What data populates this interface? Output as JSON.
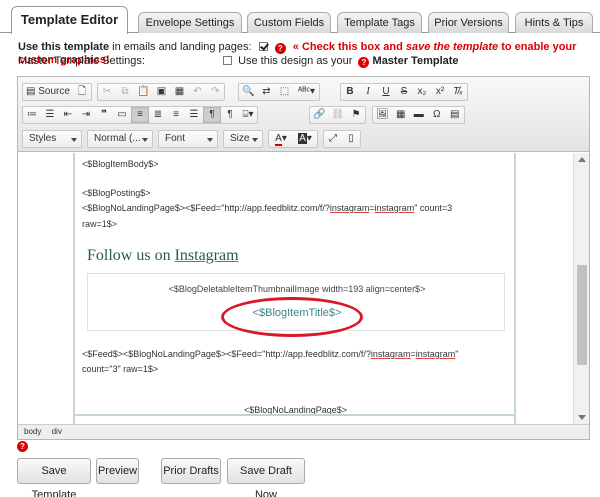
{
  "tabs": [
    {
      "label": "Template Editor",
      "active": true
    },
    {
      "label": "Envelope Settings"
    },
    {
      "label": "Custom Fields"
    },
    {
      "label": "Template Tags"
    },
    {
      "label": "Prior Versions"
    },
    {
      "label": "Hints & Tips"
    }
  ],
  "options": {
    "use_template_label": "Use this template",
    "use_template_suffix": " in emails and landing pages:",
    "use_template_checked": true,
    "warning_prefix": "« Check this box and ",
    "warning_italic": "save the template",
    "warning_suffix": " to enable your custom graphics!",
    "master_label": "Master Template Settings:",
    "master_checkbox_label": "Use this design as your",
    "master_template_label": "Master Template",
    "master_checked": false
  },
  "toolbar": {
    "row1": [
      "Source",
      "New Page",
      "Cut",
      "Copy",
      "Paste",
      "Paste as text",
      "Paste from Word",
      "Undo",
      "Redo",
      "Find",
      "Replace",
      "Select All",
      "Spell Check",
      "Bold",
      "Italic",
      "Underline",
      "Strike",
      "Subscript",
      "Superscript",
      "Remove Format"
    ],
    "source_label": "Source",
    "combos": {
      "styles": "Styles",
      "format": "Normal (...",
      "font": "Font",
      "size": "Size"
    }
  },
  "content": {
    "blog_item_body": "<$BlogItemBody$>",
    "blog_posting": "<$BlogPosting$>",
    "feed_line_1a": "<$BlogNoLandingPage$><$Feed=\"http://app.feedblitz.com/f/?",
    "feed_word": "instagram",
    "feed_line_1b": "=",
    "feed_line_1c": "\" count=3",
    "feed_line_2": "raw=1$>",
    "heading_prefix": "Follow us on ",
    "heading_word": "Instagram",
    "thumb_line": "<$BlogDeletableItemThumbnailImage width=193 align=center$>",
    "item_title": "<$BlogItemTitle$>",
    "end_feed_a": "<$Feed$><$BlogNoLandingPage$><$Feed=\"http://app.feedblitz.com/f/?",
    "end_feed_b": "\"",
    "end_feed_2": "count=\"3\" raw=1$>",
    "no_landing": "<$BlogNoLandingPage$>"
  },
  "statusbar": [
    "body",
    "div"
  ],
  "buttons": {
    "save_template": "Save Template",
    "preview": "Preview",
    "prior_drafts": "Prior Drafts",
    "save_draft_now": "Save Draft Now"
  },
  "colors": {
    "accent_red": "#d00000",
    "heading_teal": "#2a5a52",
    "link_teal": "#3a8585",
    "highlight_oval": "#d7192a"
  }
}
